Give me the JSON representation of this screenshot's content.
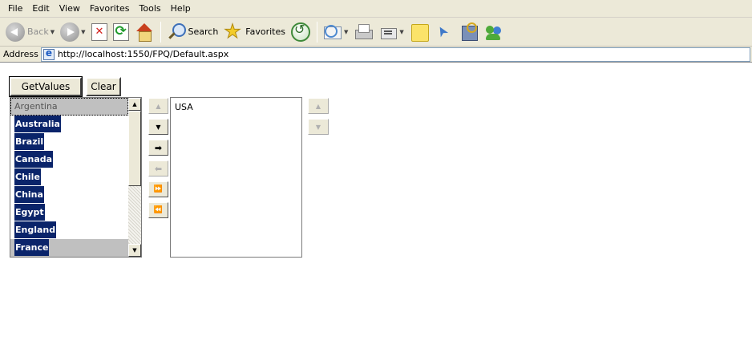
{
  "menu": [
    "File",
    "Edit",
    "View",
    "Favorites",
    "Tools",
    "Help"
  ],
  "toolbar": {
    "back_label": "Back",
    "search_label": "Search",
    "favorites_label": "Favorites"
  },
  "address": {
    "label": "Address",
    "url": "http://localhost:1550/FPQ/Default.aspx"
  },
  "page": {
    "get_values_label": "GetValues",
    "clear_label": "Clear",
    "left_list": [
      "Argentina",
      "Australia",
      "Brazil",
      "Canada",
      "Chile",
      "China",
      "Egypt",
      "England",
      "France"
    ],
    "right_list": [
      "USA"
    ]
  },
  "controls": {
    "up_icon": "▲",
    "down_icon": "▼",
    "move_right_icon": "➡",
    "move_left_icon": "⬅",
    "move_all_right_icon": "⏩",
    "move_all_left_icon": "⏪"
  },
  "colors": {
    "selection": "#0a246a",
    "chrome": "#ece9d8"
  }
}
